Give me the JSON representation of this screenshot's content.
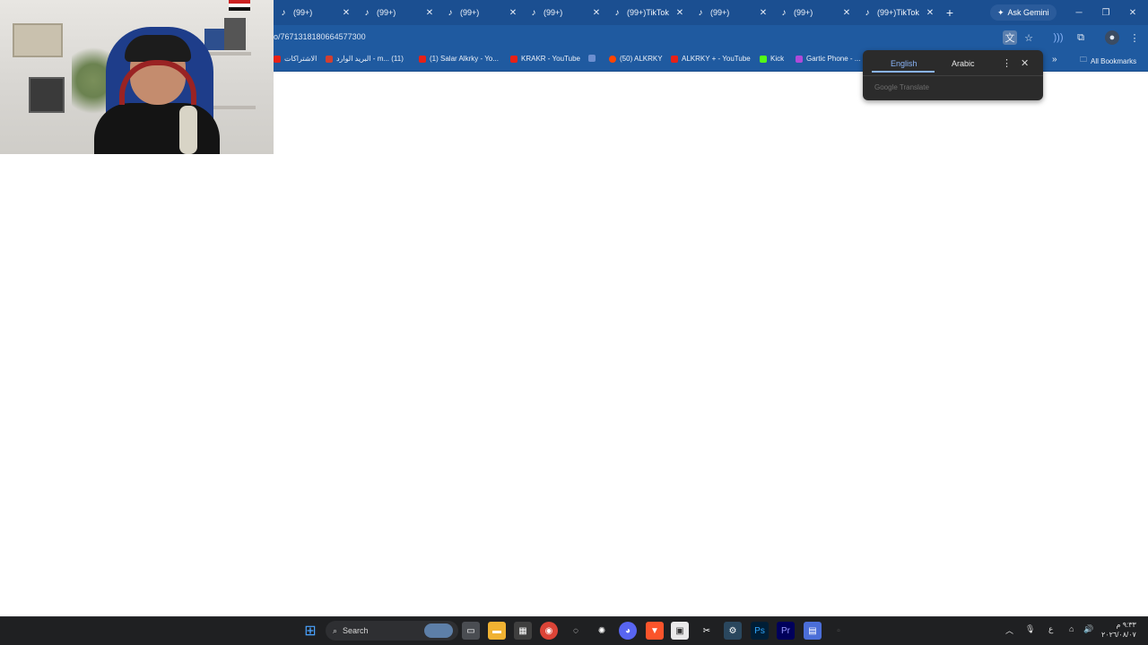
{
  "browser": {
    "tabs": [
      {
        "title": "(99+)"
      },
      {
        "title": "(99+)"
      },
      {
        "title": "(99+)"
      },
      {
        "title": "(99+)"
      },
      {
        "title": "(99+)TikTok"
      },
      {
        "title": "(99+)"
      },
      {
        "title": "(99+)"
      },
      {
        "title": "(99+)TikTok"
      }
    ],
    "tab_close": "✕",
    "new_tab": "+",
    "ask_gemini": "Ask Gemini",
    "url_fragment": "o/7671318180664577300",
    "bookmarks": [
      {
        "label": "الاشتراكات",
        "color": "#e62117"
      },
      {
        "label": "البريد الوارد - m... (11)",
        "color": "#d23f31"
      },
      {
        "label": "(1) Salar Alkrky - Yo...",
        "color": "#e62117"
      },
      {
        "label": "KRAKR - YouTube",
        "color": "#e62117"
      },
      {
        "label": "(50) ALKRKY",
        "color": "#ff4500"
      },
      {
        "label": "ALKRKY + - YouTube",
        "color": "#e62117"
      },
      {
        "label": "Kick",
        "color": "#53fc18"
      },
      {
        "label": "Gartic Phone - ...",
        "color": "#b04ad8"
      }
    ],
    "bookmarks_overflow": "»",
    "all_bookmarks": "All Bookmarks"
  },
  "translate_popup": {
    "source_lang": "English",
    "target_lang": "Arabic",
    "brand": "Google Translate",
    "more_icon": "⋮",
    "close_icon": "✕"
  },
  "taskbar": {
    "search_label": "Search",
    "clock_time": "٩:٣٣ م",
    "clock_date": "٢٠٢٦/٠٨/٠٧",
    "lang_indicator": "ع"
  }
}
